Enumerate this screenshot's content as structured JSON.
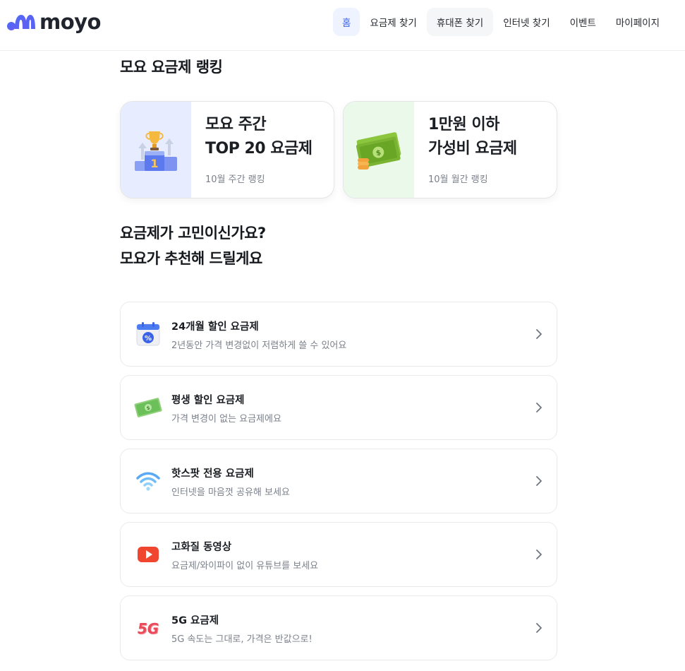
{
  "header": {
    "logo_text": "moyo",
    "nav": [
      {
        "label": "홈"
      },
      {
        "label": "요금제 찾기"
      },
      {
        "label": "휴대폰 찾기"
      },
      {
        "label": "인터넷 찾기"
      },
      {
        "label": "이벤트"
      },
      {
        "label": "마이페이지"
      }
    ]
  },
  "ranking": {
    "title": "모요 요금제 랭킹",
    "cards": [
      {
        "title": "모요 주간\nTOP 20 요금제",
        "subtitle": "10월 주간 랭킹",
        "icon": "trophy-podium-icon",
        "thumb_color": "#e8ecff"
      },
      {
        "title": "1만원 이하\n가성비 요금제",
        "subtitle": "10월 월간 랭킹",
        "icon": "cash-icon",
        "thumb_color": "#ebf9ea"
      }
    ]
  },
  "recommend": {
    "title_line1": "요금제가 고민이신가요?",
    "title_line2": "모요가 추천해 드릴게요",
    "items": [
      {
        "title": "24개월 할인 요금제",
        "subtitle": "2년동안 가격 변경없이 저렴하게 쓸 수 있어요",
        "icon": "calendar-percent-icon"
      },
      {
        "title": "평생 할인 요금제",
        "subtitle": "가격 변경이 없는 요금제에요",
        "icon": "money-bill-icon"
      },
      {
        "title": "핫스팟 전용 요금제",
        "subtitle": "인터넷을 마음껏 공유해 보세요",
        "icon": "wifi-icon"
      },
      {
        "title": "고화질 동영상",
        "subtitle": "요금제/와이파이 없이 유튜브를 보세요",
        "icon": "video-play-icon"
      },
      {
        "title": "5G 요금제",
        "subtitle": "5G 속도는 그대로, 가격은 반값으로!",
        "icon": "5g-icon"
      }
    ]
  },
  "colors": {
    "accent": "#3a63e8",
    "nav_active_bg": "#eef3ff"
  }
}
